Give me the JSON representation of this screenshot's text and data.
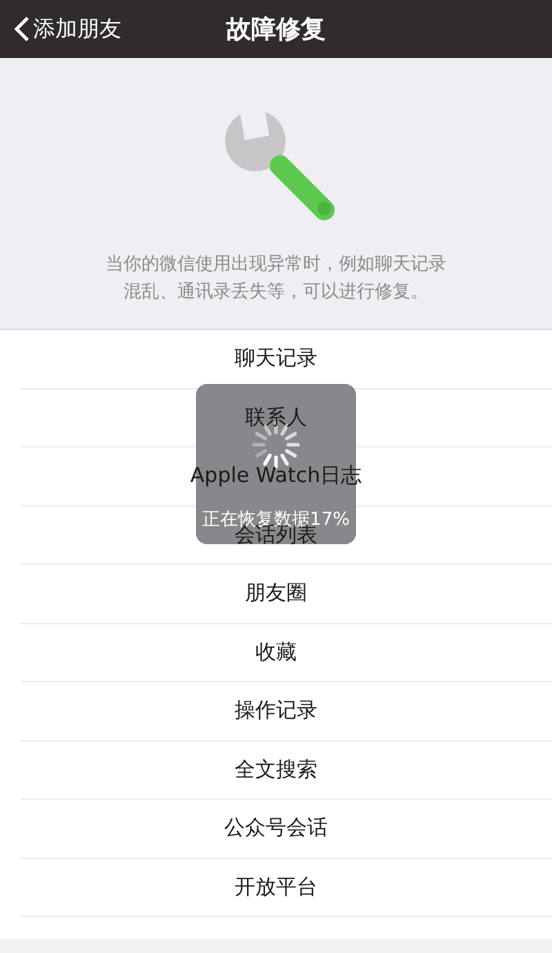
{
  "nav": {
    "back_label": "添加朋友",
    "title": "故障修复"
  },
  "description": "当你的微信使用出现异常时，例如聊天记录混乱、通讯录丢失等，可以进行修复。",
  "items": [
    "聊天记录",
    "联系人",
    "Apple Watch日志",
    "会话列表",
    "朋友圈",
    "收藏",
    "操作记录",
    "全文搜索",
    "公众号会话",
    "开放平台"
  ],
  "progress": {
    "message": "正在恢复数据17%"
  }
}
